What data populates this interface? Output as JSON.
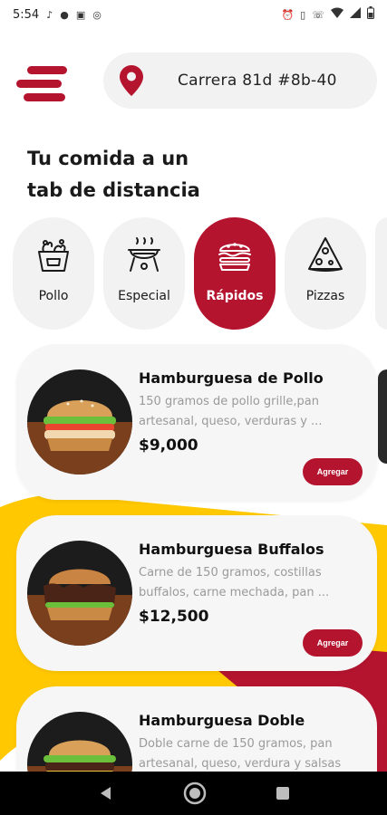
{
  "status_bar": {
    "time": "5:54",
    "left_icons": [
      "tiktok-icon",
      "apple-icon",
      "image-icon",
      "shazam-icon"
    ],
    "right_icons": [
      "alarm-icon",
      "vibrate-icon",
      "volte-icon",
      "wifi-icon",
      "signal-icon",
      "battery-icon"
    ]
  },
  "header": {
    "address": "Carrera 81d #8b-40"
  },
  "headline": "Tu comida a un\ntab de distancia",
  "categories": [
    {
      "label": "Pollo",
      "icon": "chicken-bucket-icon",
      "active": false
    },
    {
      "label": "Especial",
      "icon": "grill-icon",
      "active": false
    },
    {
      "label": "Rápidos",
      "icon": "burger-icon",
      "active": true
    },
    {
      "label": "Pizzas",
      "icon": "pizza-icon",
      "active": false
    }
  ],
  "products": [
    {
      "name": "Hamburguesa de Pollo",
      "description": "150 gramos de pollo grille,pan artesanal, queso, verduras y ...",
      "price": "$9,000",
      "button": "Agregar"
    },
    {
      "name": "Hamburguesa Buffalos",
      "description": "Carne de 150 gramos, costillas buffalos, carne mechada, pan ...",
      "price": "$12,500",
      "button": "Agregar"
    },
    {
      "name": "Hamburguesa Doble",
      "description": "Doble carne de 150 gramos, pan artesanal, queso, verdura y salsas",
      "price": "",
      "button": ""
    }
  ],
  "colors": {
    "accent": "#b5142f",
    "yellow": "#ffc800",
    "card_bg": "#f6f6f6"
  },
  "nav": [
    "back-icon",
    "home-icon",
    "recents-icon"
  ]
}
